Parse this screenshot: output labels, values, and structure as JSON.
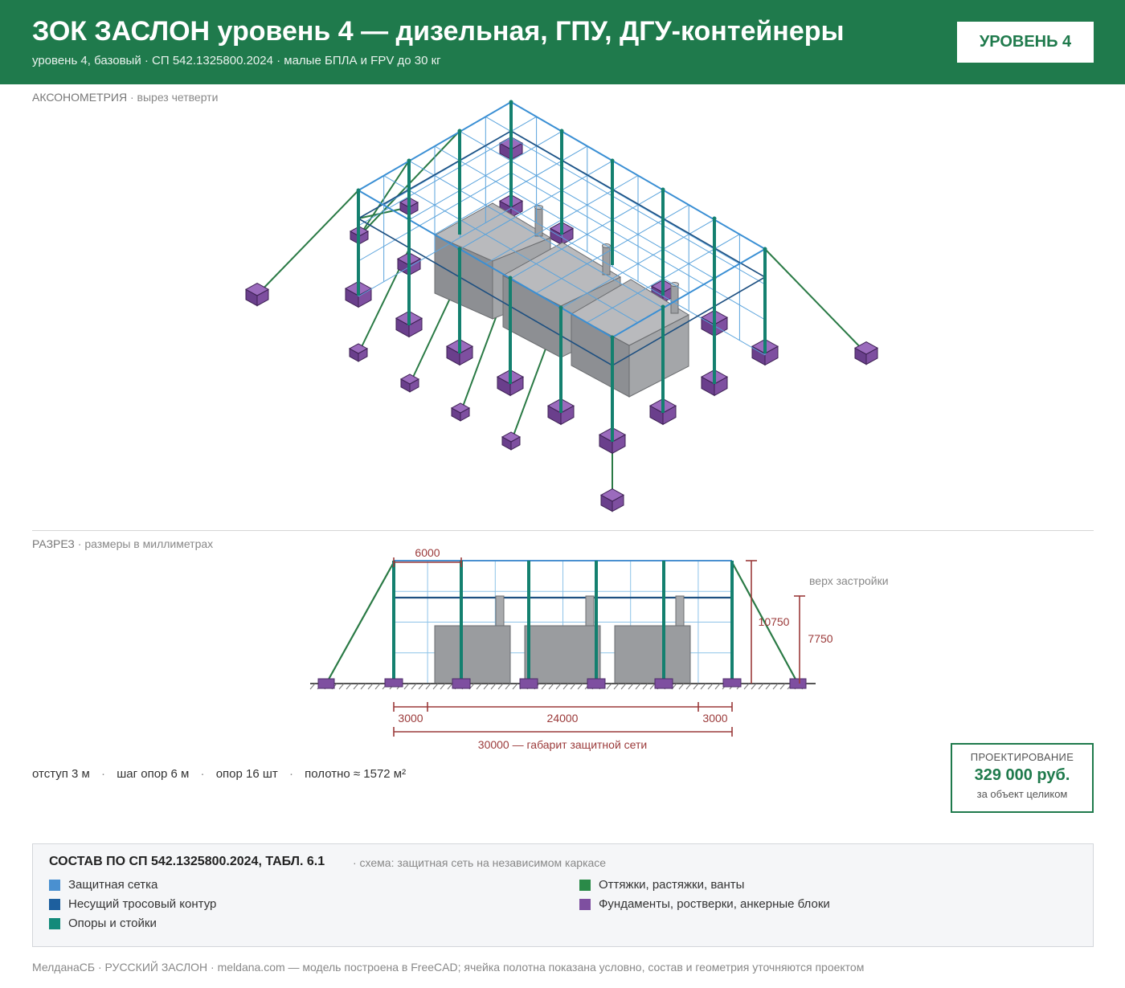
{
  "header": {
    "title": "ЗОК ЗАСЛОН уровень 4 — дизельная, ГПУ, ДГУ-контейнеры",
    "subtitle": "уровень 4, базовый · СП 542.1325800.2024 · малые БПЛА и FPV до 30 кг",
    "badge": "УРОВЕНЬ 4"
  },
  "axonometry": {
    "label": "АКСОНОМЕТРИЯ",
    "sublabel": "· вырез четверти"
  },
  "section": {
    "label": "РАЗРЕЗ",
    "sublabel": "· размеры в миллиметрах",
    "dim_top": "6000",
    "dim_height": "10750",
    "dim_building": "7750",
    "building_label": "верх застройки",
    "dim_left": "3000",
    "dim_mid": "24000",
    "dim_right": "3000",
    "dim_total": "30000 — габарит защитной сети"
  },
  "stats": {
    "offset": "отступ 3 м",
    "step": "шаг опор 6 м",
    "supports": "опор 16 шт",
    "area": "полотно ≈ 1572 м²"
  },
  "price": {
    "label": "ПРОЕКТИРОВАНИЕ",
    "value": "329 000 руб.",
    "note": "за объект целиком"
  },
  "legend": {
    "title": "СОСТАВ ПО СП 542.1325800.2024, ТАБЛ. 6.1",
    "scheme": "· схема: защитная сеть на независимом каркасе",
    "items": [
      {
        "label": "Защитная сетка",
        "color": "#4a90d0"
      },
      {
        "label": "Несущий тросовый контур",
        "color": "#1d5f9e"
      },
      {
        "label": "Опоры и стойки",
        "color": "#138a7a"
      },
      {
        "label": "Оттяжки, растяжки, ванты",
        "color": "#2a8a48"
      },
      {
        "label": "Фундаменты, ростверки, анкерные блоки",
        "color": "#7e4fa0"
      }
    ]
  },
  "footer": "МелданаСБ · РУССКИЙ ЗАСЛОН · meldana.com — модель построена в FreeCAD; ячейка полотна показана условно, состав и геометрия уточняются проектом"
}
